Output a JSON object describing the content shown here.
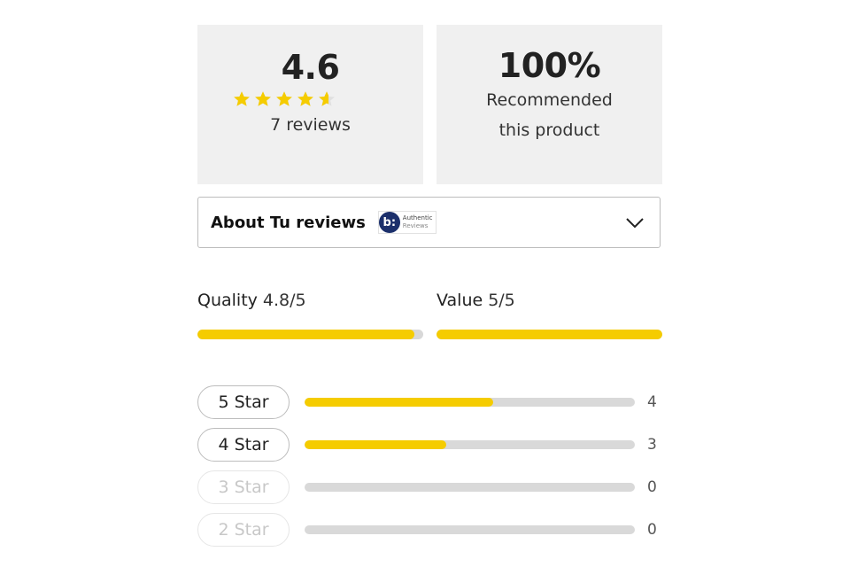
{
  "summary": {
    "average_rating": "4.6",
    "rating_value": 4.6,
    "rating_max": 5,
    "review_count_label": "7 reviews",
    "recommend_percent": "100%",
    "recommend_line1": "Recommended",
    "recommend_line2": "this product"
  },
  "about": {
    "title": "About Tu reviews",
    "badge_logo": "b:",
    "badge_line1": "Authentic",
    "badge_line2": "Reviews",
    "expand_icon": "chevron-down-icon"
  },
  "metrics": [
    {
      "label": "Quality",
      "score": "4.8/5",
      "fraction": 0.96
    },
    {
      "label": "Value",
      "score": "5/5",
      "fraction": 1.0
    }
  ],
  "distribution": [
    {
      "label": "5 Star",
      "count": "4",
      "fraction": 0.5714,
      "enabled": true
    },
    {
      "label": "4 Star",
      "count": "3",
      "fraction": 0.4286,
      "enabled": true
    },
    {
      "label": "3 Star",
      "count": "0",
      "fraction": 0,
      "enabled": false
    },
    {
      "label": "2 Star",
      "count": "0",
      "fraction": 0,
      "enabled": false
    }
  ],
  "colors": {
    "accent": "#f5cc00",
    "track": "#d9d9d9",
    "card_bg": "#f0f0f0",
    "badge_blue": "#1b2f6b"
  }
}
